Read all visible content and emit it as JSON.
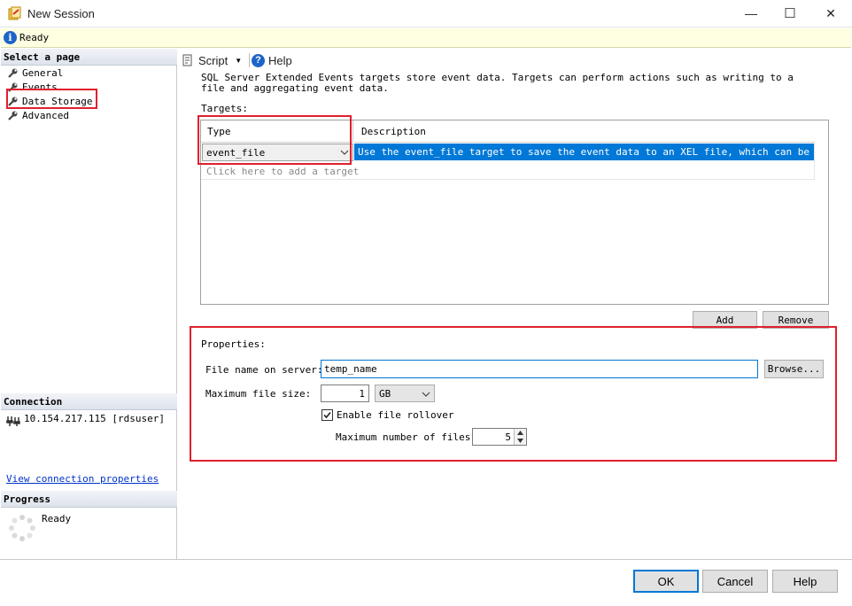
{
  "window": {
    "title": "New Session",
    "minimize_glyph": "—",
    "maximize_glyph": "☐",
    "close_glyph": "✕"
  },
  "status": {
    "icon": "info-icon",
    "icon_glyph": "i",
    "text": "Ready"
  },
  "left_pane": {
    "select_page_header": "Select a page",
    "pages": [
      {
        "label": "General",
        "icon": "wrench-icon"
      },
      {
        "label": "Events",
        "icon": "wrench-icon"
      },
      {
        "label": "Data Storage",
        "icon": "wrench-icon"
      },
      {
        "label": "Advanced",
        "icon": "wrench-icon"
      }
    ],
    "connection_header": "Connection",
    "connection_text": "10.154.217.115 [rdsuser]",
    "connection_link": "View connection properties",
    "progress_header": "Progress",
    "progress_text": "Ready"
  },
  "toolbar": {
    "script_label": "Script",
    "script_icon": "script-icon",
    "help_label": "Help",
    "help_icon": "help-icon"
  },
  "description": "SQL Server Extended Events targets store event data. Targets can perform actions such as writing to a file and aggregating event data.",
  "targets": {
    "label": "Targets:",
    "columns": [
      "Type",
      "Description"
    ],
    "rows": [
      {
        "type": "event_file",
        "description": "Use the event_file target to save the event data to an XEL file, which can be arch..."
      }
    ],
    "add_row_text": "Click here to add a target",
    "add_button": "Add",
    "remove_button": "Remove"
  },
  "properties": {
    "label": "Properties:",
    "file_name_label": "File name on server:",
    "file_name_value": "temp_name",
    "browse_button": "Browse...",
    "max_size_label": "Maximum file size:",
    "max_size_value": "1",
    "max_size_unit": "GB",
    "rollover_label": "Enable file rollover",
    "rollover_checked": true,
    "max_files_label": "Maximum number of files:",
    "max_files_value": "5"
  },
  "footer": {
    "ok": "OK",
    "cancel": "Cancel",
    "help": "Help"
  },
  "colors": {
    "accent": "#0078d7",
    "highlight": "#e0202e",
    "status_bg": "#ffffe1"
  }
}
